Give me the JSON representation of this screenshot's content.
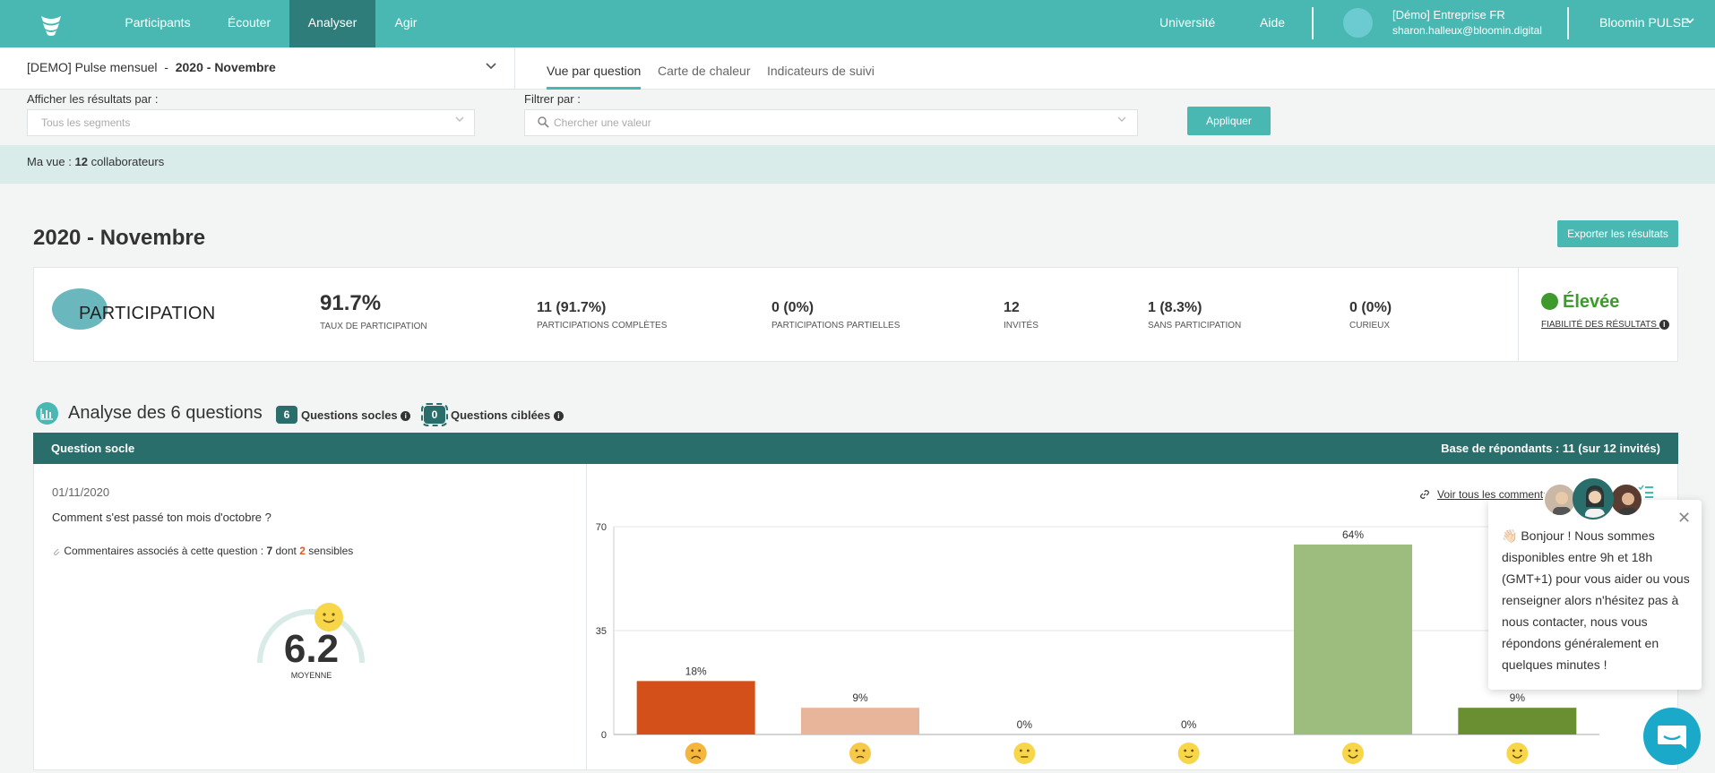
{
  "nav": {
    "items": [
      "Participants",
      "Écouter",
      "Analyser",
      "Agir"
    ],
    "active_index": 2,
    "right_links": [
      "Université",
      "Aide"
    ],
    "account_name": "[Démo] Entreprise FR",
    "account_email": "sharon.halleux@bloomin.digital",
    "product": "Bloomin PULSE"
  },
  "survey": {
    "name": "[DEMO] Pulse mensuel",
    "separator": "-",
    "period": "2020 - Novembre",
    "tabs": [
      "Vue par question",
      "Carte de chaleur",
      "Indicateurs de suivi"
    ]
  },
  "filters": {
    "group_label": "Afficher les résultats par :",
    "group_placeholder": "Tous les segments",
    "filter_label": "Filtrer par :",
    "filter_placeholder": "Chercher une valeur",
    "apply": "Appliquer"
  },
  "my_view": {
    "prefix": "Ma vue :",
    "count": "12",
    "suffix": "collaborateurs"
  },
  "page": {
    "title": "2020 - Novembre",
    "export": "Exporter les résultats"
  },
  "participation": {
    "title": "PARTICIPATION",
    "stats": [
      {
        "value": "91.7%",
        "label": "Taux de participation"
      },
      {
        "value": "11 (91.7%)",
        "label": "Participations complètes"
      },
      {
        "value": "0 (0%)",
        "label": "Participations partielles"
      },
      {
        "value": "12",
        "label": "Invités"
      },
      {
        "value": "1 (8.3%)",
        "label": "Sans participation"
      },
      {
        "value": "0 (0%)",
        "label": "Curieux"
      }
    ],
    "reliability_value": "Élevée",
    "reliability_label": "Fiabilité des résultats",
    "reliability_color": "#3e9a2d"
  },
  "analysis": {
    "title": "Analyse des 6 questions",
    "core_count": "6",
    "core_label": "Questions socles",
    "targeted_count": "0",
    "targeted_label": "Questions ciblées"
  },
  "question": {
    "type": "Question socle",
    "base": "Base de répondants : 11 (sur 12 invités)",
    "date": "01/11/2020",
    "text": "Comment s'est passé ton mois d'octobre ?",
    "comments_prefix": "Commentaires associés à cette question :",
    "comments_total": "7",
    "comments_mid": "dont",
    "comments_sensitive": "2",
    "comments_suffix": "sensibles",
    "average": "6.2",
    "average_label": "MOYENNE",
    "see_comments": "Voir tous les commentaires"
  },
  "chart_data": {
    "type": "bar",
    "categories": [
      "very-sad-face",
      "sad-face",
      "neutral-face",
      "slightly-smiling-face",
      "smiling-face",
      "heart-eyes-face"
    ],
    "values": [
      18,
      9,
      0,
      0,
      64,
      9
    ],
    "labels": [
      "18%",
      "9%",
      "0%",
      "0%",
      "64%",
      "9%"
    ],
    "colors": [
      "#d4501a",
      "#e8b49a",
      "#cccccc",
      "#cccccc",
      "#9cbd7e",
      "#6a8e32"
    ],
    "yticks": [
      0,
      35,
      70
    ],
    "ylim": [
      0,
      70
    ],
    "grid": true
  },
  "chat": {
    "message": "👋🏻 Bonjour ! Nous sommes disponibles entre 9h et 18h (GMT+1) pour vous aider ou vous renseigner alors n'hésitez pas à nous contacter, nous vous répondons généralement en quelques minutes !"
  }
}
